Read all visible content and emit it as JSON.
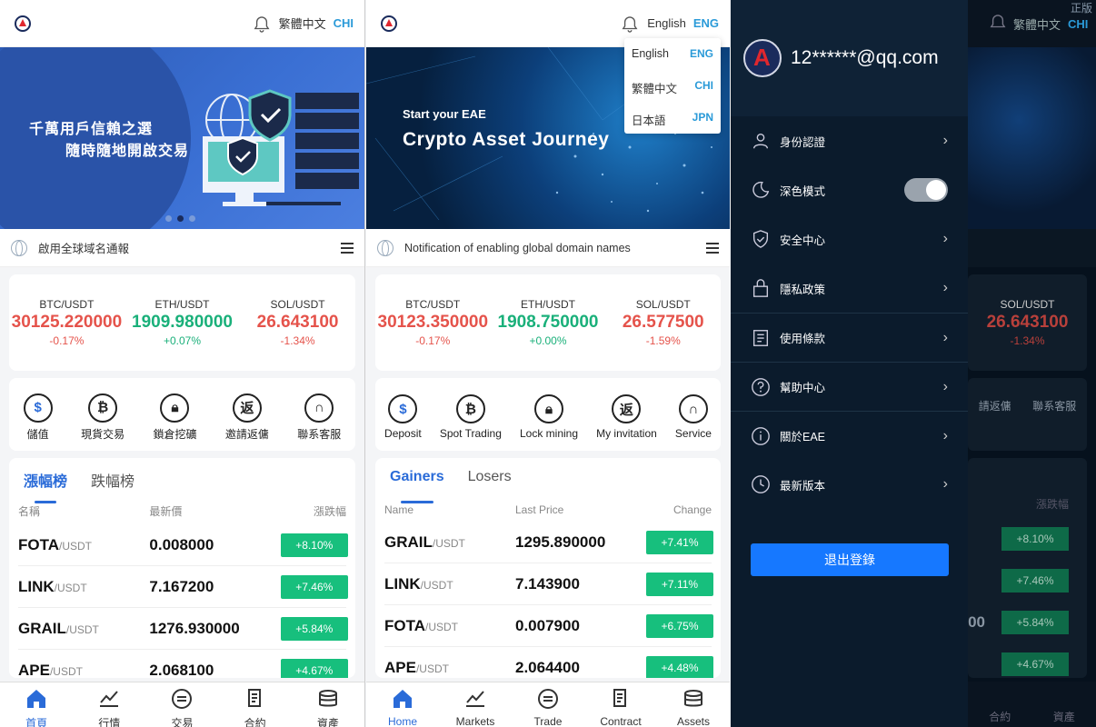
{
  "panel1": {
    "lang_label": "繁體中文",
    "lang_code": "CHI",
    "banner_line1": "千萬用戶信賴之選",
    "banner_line2": "隨時隨地開啟交易",
    "notice": "啟用全球域名通報",
    "tickers": [
      {
        "pair": "BTC/USDT",
        "price": "30125.220000",
        "change": "-0.17%"
      },
      {
        "pair": "ETH/USDT",
        "price": "1909.980000",
        "change": "+0.07%"
      },
      {
        "pair": "SOL/USDT",
        "price": "26.643100",
        "change": "-1.34%"
      }
    ],
    "actions": [
      "儲值",
      "現貨交易",
      "鎖倉挖礦",
      "邀請返傭",
      "聯系客服"
    ],
    "tabs": [
      "漲幅榜",
      "跌幅榜"
    ],
    "cols": [
      "名稱",
      "最新價",
      "漲跌幅"
    ],
    "rows": [
      {
        "coin": "FOTA",
        "quote": "/USDT",
        "price": "0.008000",
        "change": "+8.10%"
      },
      {
        "coin": "LINK",
        "quote": "/USDT",
        "price": "7.167200",
        "change": "+7.46%"
      },
      {
        "coin": "GRAIL",
        "quote": "/USDT",
        "price": "1276.930000",
        "change": "+5.84%"
      },
      {
        "coin": "APE",
        "quote": "/USDT",
        "price": "2.068100",
        "change": "+4.67%"
      }
    ],
    "nav": [
      "首頁",
      "行情",
      "交易",
      "合約",
      "資產"
    ]
  },
  "panel2": {
    "lang_label": "English",
    "lang_code": "ENG",
    "dropdown": [
      {
        "label": "English",
        "code": "ENG"
      },
      {
        "label": "繁體中文",
        "code": "CHI"
      },
      {
        "label": "日本語",
        "code": "JPN"
      }
    ],
    "banner_line1": "Start your EAE",
    "banner_line2": "Crypto Asset Journey",
    "notice": "Notification of enabling global domain names",
    "tickers": [
      {
        "pair": "BTC/USDT",
        "price": "30123.350000",
        "change": "-0.17%"
      },
      {
        "pair": "ETH/USDT",
        "price": "1908.750000",
        "change": "+0.00%"
      },
      {
        "pair": "SOL/USDT",
        "price": "26.577500",
        "change": "-1.59%"
      }
    ],
    "actions": [
      "Deposit",
      "Spot Trading",
      "Lock mining",
      "My invitation",
      "Service"
    ],
    "tabs": [
      "Gainers",
      "Losers"
    ],
    "cols": [
      "Name",
      "Last Price",
      "Change"
    ],
    "rows": [
      {
        "coin": "GRAIL",
        "quote": "/USDT",
        "price": "1295.890000",
        "change": "+7.41%"
      },
      {
        "coin": "LINK",
        "quote": "/USDT",
        "price": "7.143900",
        "change": "+7.11%"
      },
      {
        "coin": "FOTA",
        "quote": "/USDT",
        "price": "0.007900",
        "change": "+6.75%"
      },
      {
        "coin": "APE",
        "quote": "/USDT",
        "price": "2.064400",
        "change": "+4.48%"
      }
    ],
    "nav": [
      "Home",
      "Markets",
      "Trade",
      "Contract",
      "Assets"
    ]
  },
  "panel3": {
    "email": "12******@qq.com",
    "menu": [
      "身份認證",
      "深色模式",
      "安全中心",
      "隱私政策",
      "使用條款",
      "幫助中心",
      "關於EAE",
      "最新版本"
    ],
    "logout": "退出登錄",
    "bg_lang_label": "繁體中文",
    "bg_lang_code": "CHI",
    "bg_corner": "正版",
    "bg_ticker": {
      "pair": "SOL/USDT",
      "price": "26.643100",
      "change": "-1.34%"
    },
    "bg_actions": [
      "請返傭",
      "聯系客服"
    ],
    "bg_col": "漲跌幅",
    "bg_rows": [
      {
        "price": "",
        "change": "+8.10%"
      },
      {
        "price": "",
        "change": "+7.46%"
      },
      {
        "price": "00",
        "change": "+5.84%"
      },
      {
        "price": "",
        "change": "+4.67%"
      }
    ],
    "bg_nav": [
      "合約",
      "資產"
    ]
  }
}
